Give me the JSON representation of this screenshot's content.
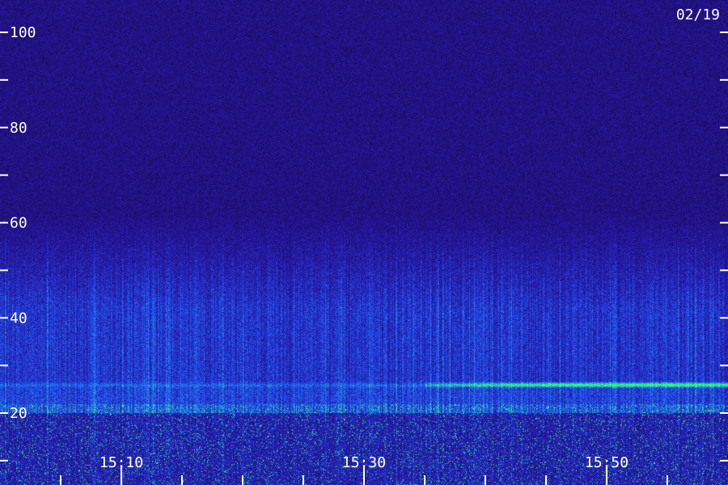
{
  "chart_data": {
    "type": "heatmap",
    "date_label": "02/19",
    "y_axis": {
      "tick_labels": [
        "100",
        "80",
        "60",
        "40",
        "20"
      ],
      "tick_values": [
        100,
        80,
        60,
        40,
        20
      ],
      "minor_tick_values": [
        110,
        90,
        70,
        50,
        30,
        10
      ],
      "range": [
        5,
        110
      ]
    },
    "x_axis": {
      "tick_labels": [
        "15:10",
        "15:30",
        "15:50"
      ],
      "tick_minutes": [
        10,
        30,
        50
      ],
      "minor_tick_minutes": [
        5,
        15,
        20,
        25,
        35,
        40,
        45,
        55
      ],
      "range_minutes": [
        0,
        60
      ]
    },
    "features": [
      {
        "kind": "band",
        "value_low": 20,
        "value_high": 60,
        "description_level": "broadband emission"
      },
      {
        "kind": "line",
        "value": 26,
        "start_minute": 35,
        "end_minute": 60,
        "level": "strong"
      },
      {
        "kind": "band",
        "value_low": 5,
        "value_high": 22,
        "level": "dense speckle"
      }
    ],
    "colors": {
      "background": "#14083a",
      "low": "#2418a8",
      "mid": "#2a5cff",
      "high": "#30ff70"
    }
  }
}
